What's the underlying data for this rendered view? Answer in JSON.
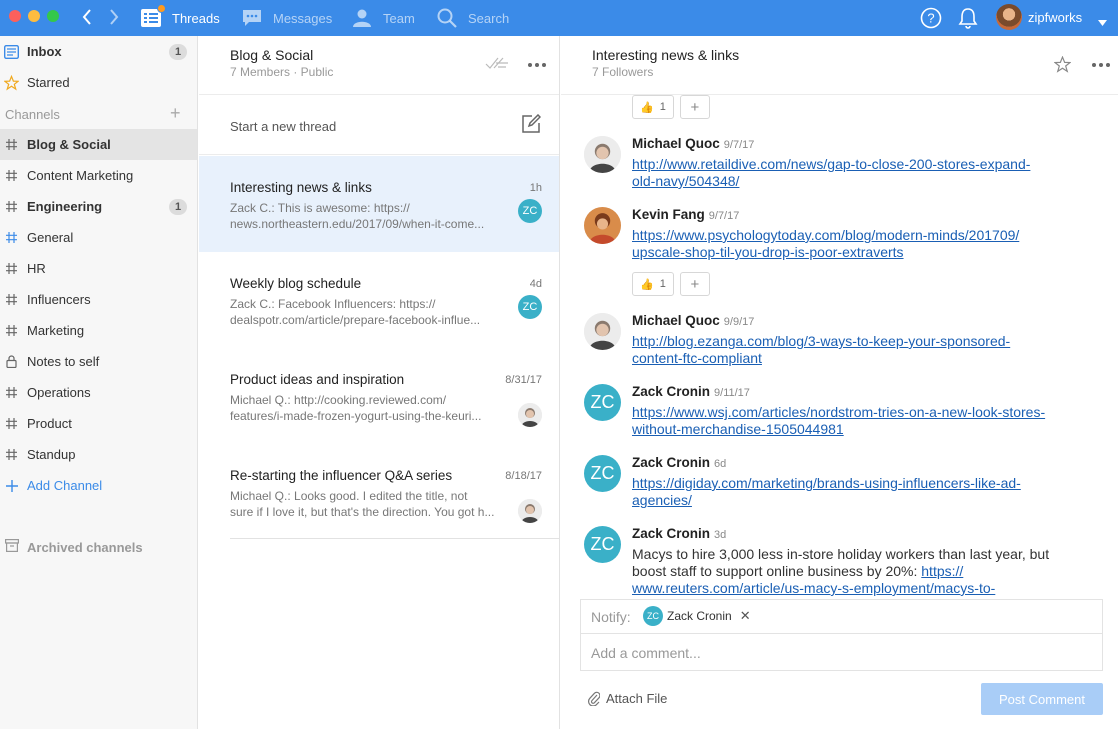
{
  "topbar": {
    "nav": [
      {
        "label": "Threads",
        "icon": "threads-icon",
        "active": true
      },
      {
        "label": "Messages",
        "icon": "messages-icon",
        "active": false
      },
      {
        "label": "Team",
        "icon": "team-icon",
        "active": false
      },
      {
        "label": "Search",
        "icon": "search-icon",
        "active": false
      }
    ],
    "user_name": "zipfworks",
    "accent_color": "#3b8be8"
  },
  "sidebar": {
    "inbox": {
      "label": "Inbox",
      "count": "1"
    },
    "starred": {
      "label": "Starred"
    },
    "channels_title": "Channels",
    "channels": [
      {
        "label": "Blog & Social",
        "active": true
      },
      {
        "label": "Content Marketing"
      },
      {
        "label": "Engineering",
        "bold": true,
        "count": "1"
      },
      {
        "label": "General"
      },
      {
        "label": "HR"
      },
      {
        "label": "Influencers"
      },
      {
        "label": "Marketing"
      },
      {
        "label": "Notes to self",
        "locked": true
      },
      {
        "label": "Operations"
      },
      {
        "label": "Product"
      },
      {
        "label": "Standup"
      }
    ],
    "add_channel": "Add Channel",
    "archived": "Archived channels"
  },
  "threads_pane": {
    "title": "Blog & Social",
    "subtitle": "7 Members · Public",
    "new_thread": "Start a new thread",
    "threads": [
      {
        "title": "Interesting news & links",
        "time": "1h",
        "line1": "Zack C.: This is awesome: https://",
        "line2": "news.northeastern.edu/2017/09/when-it-come...",
        "avatar": "ZC"
      },
      {
        "title": "Weekly blog schedule",
        "time": "4d",
        "line1": "Zack C.: Facebook Influencers: https://",
        "line2": "dealspotr.com/article/prepare-facebook-influe...",
        "avatar": "ZC"
      },
      {
        "title": "Product ideas and inspiration",
        "time": "8/31/17",
        "line1": "Michael Q.: http://cooking.reviewed.com/",
        "line2": "features/i-made-frozen-yogurt-using-the-keuri..."
      },
      {
        "title": "Re-starting the influencer Q&A series",
        "time": "8/18/17",
        "line1": "Michael Q.: Looks good. I edited the title, not",
        "line2": "sure if I love it, but that's the direction. You got h..."
      }
    ]
  },
  "detail_pane": {
    "title": "Interesting news & links",
    "subtitle": "7 Followers",
    "reaction_count": "1",
    "messages": [
      {
        "author": "Michael Quoc",
        "time": "9/7/17",
        "line1": "http://www.retaildive.com/news/gap-to-close-200-stores-expand-",
        "line2": "old-navy/504348/"
      },
      {
        "author": "Kevin Fang",
        "time": "9/7/17",
        "line1": "https://www.psychologytoday.com/blog/modern-minds/201709/",
        "line2": "upscale-shop-til-you-drop-is-poor-extraverts"
      },
      {
        "author": "Michael Quoc",
        "time": "9/9/17",
        "line1": "http://blog.ezanga.com/blog/3-ways-to-keep-your-sponsored-",
        "line2": "content-ftc-compliant"
      },
      {
        "author": "Zack Cronin",
        "time": "9/11/17",
        "line1": "https://www.wsj.com/articles/nordstrom-tries-on-a-new-look-stores-",
        "line2": "without-merchandise-1505044981",
        "avatar": "ZC"
      },
      {
        "author": "Zack Cronin",
        "time": "6d",
        "line1": "https://digiday.com/marketing/brands-using-influencers-like-ad-",
        "line2": "agencies/",
        "avatar": "ZC"
      },
      {
        "author": "Zack Cronin",
        "time": "3d",
        "text1": "Macys to hire 3,000 less in-store holiday workers than last year, but",
        "text2": "boost staff to support online business by 20%: ",
        "link_a": "https://",
        "link_b": "www.reuters.com/article/us-macy-s-employment/macys-to-",
        "avatar": "ZC"
      }
    ],
    "notify_label": "Notify:",
    "notify_chip": "Zack Cronin",
    "notify_avatar": "ZC",
    "comment_placeholder": "Add a comment...",
    "attach_label": "Attach File",
    "post_label": "Post Comment"
  }
}
